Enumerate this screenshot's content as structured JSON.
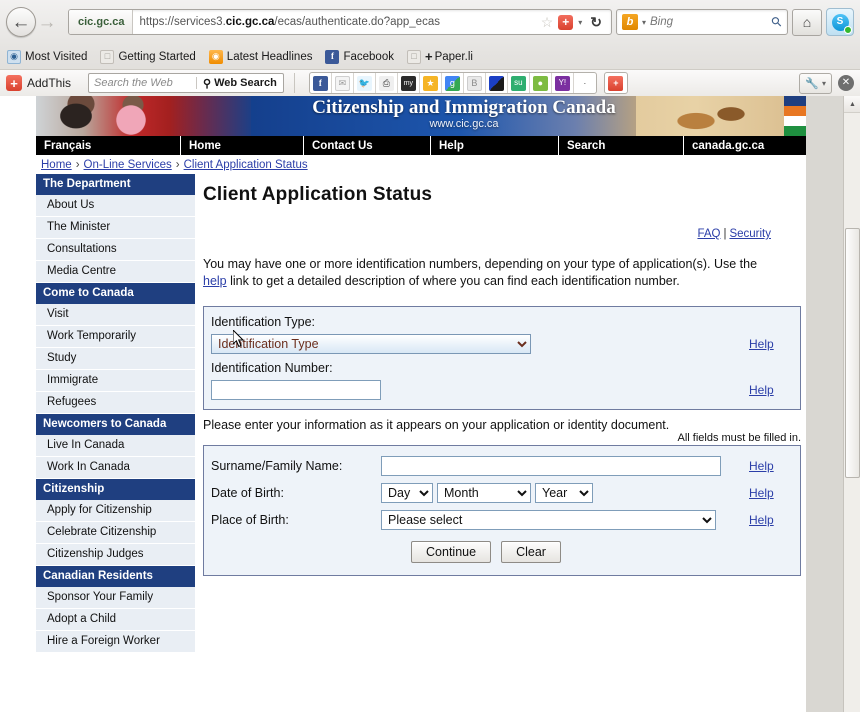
{
  "browser": {
    "back_label": "←",
    "forward_label": "→",
    "site_identity": "cic.gc.ca",
    "url_prefix": "https://services3.",
    "url_domain": "cic.gc.ca",
    "url_suffix": "/ecas/authenticate.do?app_ecas",
    "bookmark_star": "☆",
    "addon_badge": "+",
    "dropdown_caret": "▾",
    "reload_label": "↻",
    "search_engine": "Bing",
    "search_engine_icon_letter": "b",
    "search_placeholder": "Bing",
    "search_magnifier": "⚲",
    "home_label": "⌂",
    "skype_letter": "S"
  },
  "bookmarks": [
    {
      "label": "Most Visited",
      "icon": "compass-icon"
    },
    {
      "label": "Getting Started",
      "icon": "page-icon"
    },
    {
      "label": "Latest Headlines",
      "icon": "rss-icon"
    },
    {
      "label": "Facebook",
      "icon": "facebook-icon"
    },
    {
      "label": "Paper.li",
      "icon": "page-icon"
    }
  ],
  "addthis": {
    "brand": "AddThis",
    "logo_glyph": "+",
    "search_placeholder": "Search the Web",
    "search_button": "Web Search",
    "search_button_icon": "⚲",
    "wrench_icon": "🔧",
    "wrench_caret": "▾",
    "close_icon": "✕",
    "social_icons": [
      {
        "name": "facebook-share-icon",
        "glyph": "f",
        "color": "#3b5998"
      },
      {
        "name": "email-share-icon",
        "glyph": "✉",
        "color": "#f2f2f2"
      },
      {
        "name": "twitter-share-icon",
        "glyph": "t",
        "color": "#55acee"
      },
      {
        "name": "print-icon",
        "glyph": "⎙",
        "color": "#e8e8e8"
      },
      {
        "name": "myspace-share-icon",
        "glyph": "my",
        "color": "#2b2b2b"
      },
      {
        "name": "favorites-icon",
        "glyph": "★",
        "color": "#f5b425"
      },
      {
        "name": "google-share-icon",
        "glyph": "g",
        "color": "#4caf50"
      },
      {
        "name": "blogger-share-icon",
        "glyph": "B",
        "color": "#e6e6e6"
      },
      {
        "name": "delicious-share-icon",
        "glyph": "■",
        "color": "#2b5fd9"
      },
      {
        "name": "stumbleupon-share-icon",
        "glyph": "su",
        "color": "#2fae6f"
      },
      {
        "name": "digg-share-icon",
        "glyph": "d",
        "color": "#7dbb42"
      },
      {
        "name": "yahoo-share-icon",
        "glyph": "Y!",
        "color": "#7b2fa0"
      },
      {
        "name": "more-share-icon",
        "glyph": "·",
        "color": "#ffffff"
      }
    ]
  },
  "banner": {
    "title": "Citizenship and Immigration Canada",
    "url": "www.cic.gc.ca"
  },
  "topnav": [
    "Français",
    "Home",
    "Contact Us",
    "Help",
    "Search",
    "canada.gc.ca"
  ],
  "breadcrumb": {
    "items": [
      "Home",
      "On-Line Services",
      "Client Application Status"
    ],
    "separator": "›"
  },
  "sidebar": {
    "groups": [
      {
        "heading": "The Department",
        "items": [
          "About Us",
          "The Minister",
          "Consultations",
          "Media Centre"
        ]
      },
      {
        "heading": "Come to Canada",
        "items": [
          "Visit",
          "Work Temporarily",
          "Study",
          "Immigrate",
          "Refugees"
        ]
      },
      {
        "heading": "Newcomers to Canada",
        "items": [
          "Live In Canada",
          "Work In Canada"
        ]
      },
      {
        "heading": "Citizenship",
        "items": [
          "Apply for Citizenship",
          "Celebrate Citizenship",
          "Citizenship Judges"
        ]
      },
      {
        "heading": "Canadian Residents",
        "items": [
          "Sponsor Your Family",
          "Adopt a Child",
          "Hire a Foreign Worker"
        ]
      }
    ]
  },
  "page": {
    "title": "Client Application Status",
    "toplinks": {
      "faq": "FAQ",
      "divider": "|",
      "security": "Security"
    },
    "intro_part1": "You may have one or more identification numbers, depending on your type of application(s). Use the ",
    "intro_link": "help",
    "intro_part2": " link to get a detailed description of where you can find each identification number.",
    "id_section": {
      "type_label": "Identification Type:",
      "type_value": "Identification Type",
      "type_help": "Help",
      "number_label": "Identification Number:",
      "number_value": "",
      "number_help": "Help"
    },
    "notice": "Please enter your information as it appears on your application or identity document.",
    "required_note": "All fields must be filled in.",
    "info_section": {
      "surname_label": "Surname/Family Name:",
      "surname_value": "",
      "surname_help": "Help",
      "dob_label": "Date of Birth:",
      "dob_day": "Day",
      "dob_month": "Month",
      "dob_year": "Year",
      "dob_help": "Help",
      "pob_label": "Place of Birth:",
      "pob_value": "Please select",
      "pob_help": "Help"
    },
    "buttons": {
      "continue": "Continue",
      "clear": "Clear"
    }
  },
  "scrollbar": {
    "up": "▲",
    "down": "▼"
  },
  "colors": {
    "sidebar_heading_bg": "#1f3f80",
    "sidebar_item_bg": "#e9eef4",
    "form_bg": "#eef3f9",
    "form_border": "#6f7ba0",
    "link": "#2b3ea8",
    "nav_bg": "#000000"
  }
}
